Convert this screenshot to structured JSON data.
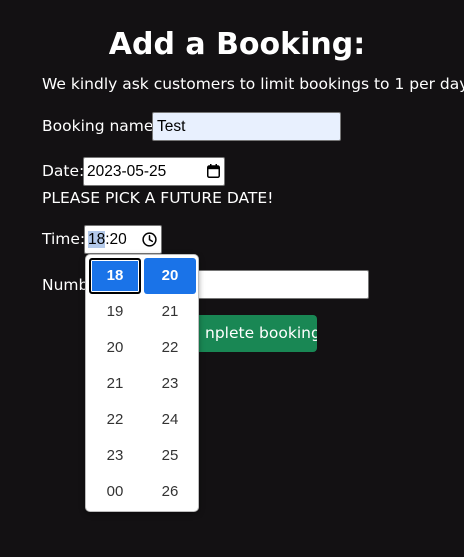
{
  "page": {
    "title": "Add a Booking:",
    "notice": "We kindly ask customers to limit bookings to 1 per day."
  },
  "form": {
    "name_label": "Booking name:",
    "name_value": "Test",
    "date_label": "Date:",
    "date_value": "2023-05-25",
    "date_warning": "PLEASE PICK A FUTURE DATE!",
    "time_label": "Time:",
    "time_hour": "18",
    "time_rest": ":20",
    "number_label": "Number of people:",
    "number_label_visible": "Numb",
    "submit_label": "Complete booking",
    "submit_label_visible": "nplete booking"
  },
  "time_picker": {
    "hours": [
      "18",
      "19",
      "20",
      "21",
      "22",
      "23",
      "00"
    ],
    "minutes": [
      "20",
      "21",
      "22",
      "23",
      "24",
      "25",
      "26"
    ],
    "selected_hour": "18",
    "selected_minute": "20"
  },
  "colors": {
    "background": "#131113",
    "submit": "#198754",
    "picker_selected": "#1a73e8",
    "autofill": "#e8f0fe"
  },
  "icons": {
    "date": "calendar-icon",
    "time": "clock-icon"
  }
}
